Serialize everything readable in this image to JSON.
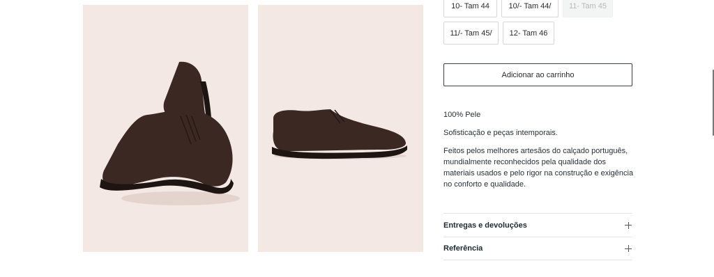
{
  "sizes": [
    {
      "label": "10- Tam 44",
      "available": true
    },
    {
      "label": "10/- Tam 44/",
      "available": true
    },
    {
      "label": "11- Tam 45",
      "available": false
    },
    {
      "label": "11/- Tam 45/",
      "available": true
    },
    {
      "label": "12- Tam 46",
      "available": true
    }
  ],
  "cart": {
    "add_label": "Adicionar ao carrinho"
  },
  "description": {
    "material": "100% Pele",
    "tagline": "Sofisticação e peças intemporais.",
    "body": "Feitos pelos melhores artesãos do calçado português, mundialmente reconhecidos pela qualidade dos materiais usados e pelo rigor na construção e exigência no conforto e qualidade."
  },
  "accordions": [
    {
      "title": "Entregas e devoluções",
      "icon": "plus-icon"
    },
    {
      "title": "Referência",
      "icon": "plus-icon"
    }
  ],
  "colors": {
    "image_bg": "#f4e8e4",
    "shoe": "#3b2822",
    "sole": "#1e1512"
  }
}
